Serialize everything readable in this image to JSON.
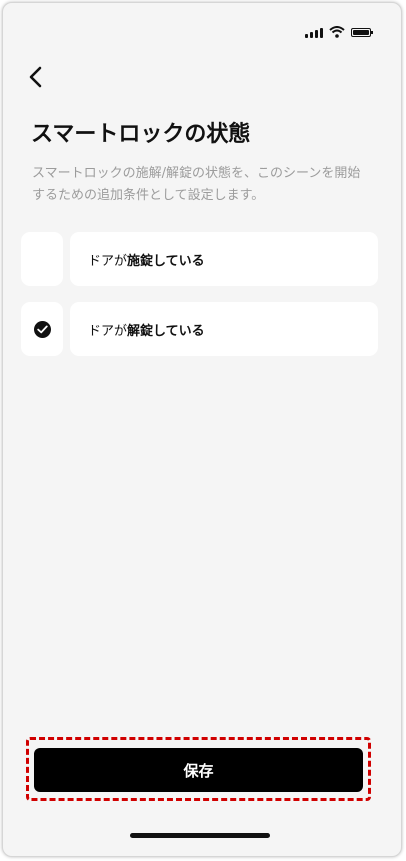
{
  "header": {
    "back_icon": "chevron-left-icon",
    "title": "スマートロックの状態",
    "description": "スマートロックの施解/解錠の状態を、このシーンを開始するための追加条件として設定します。"
  },
  "status_bar": {
    "icons": [
      "signal-icon",
      "wifi-icon",
      "battery-icon"
    ]
  },
  "options": [
    {
      "prefix": "ドアが",
      "emphasis": "施錠している",
      "checked": false
    },
    {
      "prefix": "ドアが",
      "emphasis": "解錠している",
      "checked": true
    }
  ],
  "footer": {
    "save_label": "保存"
  },
  "colors": {
    "highlight": "#d00000",
    "primary": "#000000",
    "background": "#f5f5f5"
  }
}
